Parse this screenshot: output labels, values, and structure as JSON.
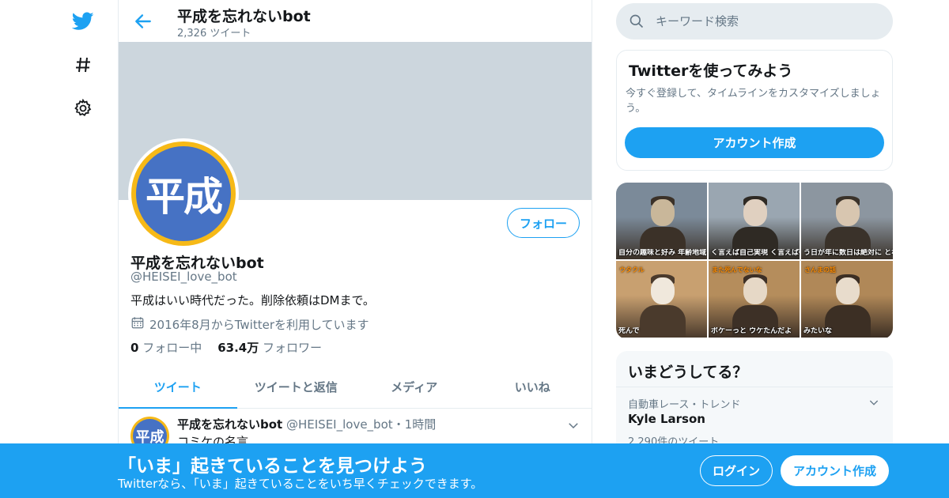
{
  "nav": {
    "icons": [
      "twitter-logo",
      "hashtag-icon",
      "gear-icon"
    ]
  },
  "header": {
    "title": "平成を忘れないbot",
    "tweet_count": "2,326 ツイート"
  },
  "profile": {
    "avatar_text": "平成",
    "name": "平成を忘れないbot",
    "handle": "@HEISEI_love_bot",
    "bio": "平成はいい時代だった。削除依頼はDMまで。",
    "joined": "2016年8月からTwitterを利用しています",
    "following_count": "0",
    "following_label": "フォロー中",
    "followers_count": "63.4万",
    "followers_label": "フォロワー",
    "follow_button": "フォロー"
  },
  "tabs": [
    {
      "label": "ツイート",
      "active": true
    },
    {
      "label": "ツイートと返信",
      "active": false
    },
    {
      "label": "メディア",
      "active": false
    },
    {
      "label": "いいね",
      "active": false
    }
  ],
  "tweet": {
    "avatar_text": "平成",
    "name": "平成を忘れないbot",
    "handle": "@HEISEI_love_bot",
    "separator": "・",
    "time": "1時間",
    "text": "コミケの名言"
  },
  "search": {
    "placeholder": "キーワード検索"
  },
  "signup_card": {
    "title": "Twitterを使ってみよう",
    "description": "今すぐ登録して、タイムラインをカスタマイズしましょう。",
    "button": "アカウント作成"
  },
  "media": {
    "thumbs": [
      {
        "caption": "自分の趣味と好み 年齢地域 全て吐き出して恐れない",
        "tag": "",
        "colors": [
          "#7b8a99",
          "#c9b79a",
          "#3b3128"
        ]
      },
      {
        "caption": "く言えば自己実現 く言えば徹底的にバカになる",
        "tag": "",
        "colors": [
          "#9aa6b1",
          "#e0d0c0",
          "#2f2a24"
        ]
      },
      {
        "caption": "う日が年に数日は絶対に となりに来ました",
        "tag": "",
        "colors": [
          "#8c96a0",
          "#d8c6b0",
          "#3a322a"
        ]
      },
      {
        "caption": "死んで",
        "tag": "ウタクル",
        "colors": [
          "#c8a070",
          "#f0e8dc",
          "#4a3a2c"
        ]
      },
      {
        "caption": "ポケーっと ウケたんだよ",
        "tag": "また死んでないな",
        "colors": [
          "#b58d5c",
          "#e6d8c6",
          "#3d3026"
        ]
      },
      {
        "caption": "みたいな",
        "tag": "さんまの話",
        "colors": [
          "#b08858",
          "#e8dccc",
          "#3c2f24"
        ]
      }
    ]
  },
  "trends": {
    "title": "いまどうしてる？",
    "items": [
      {
        "meta": "自動車レース・トレンド",
        "name": "Kyle Larson",
        "count": "2,290件のツイート"
      }
    ]
  },
  "bottom_bar": {
    "title": "「いま」起きていることを見つけよう",
    "subtitle": "Twitterなら、「いま」起きていることをいち早くチェックできます。",
    "login": "ログイン",
    "signup": "アカウント作成"
  },
  "colors": {
    "accent": "#1da1f2",
    "banner": "#ccd6dd",
    "avatar_ring": "#f6b917",
    "avatar_fill": "#4672c4"
  }
}
